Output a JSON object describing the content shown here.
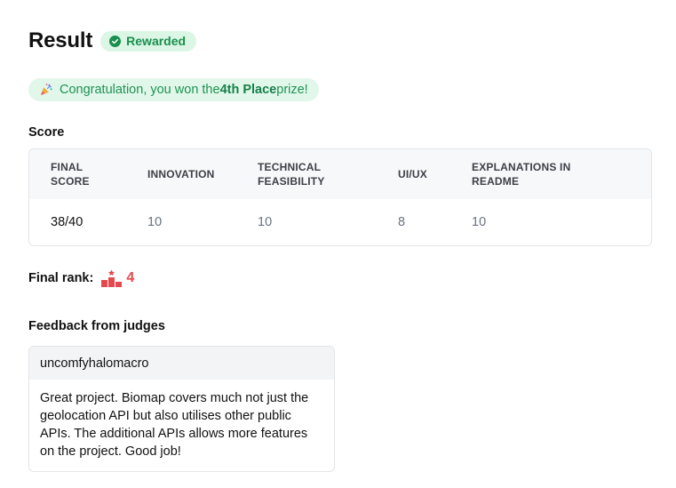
{
  "header": {
    "title": "Result",
    "badge": "Rewarded"
  },
  "congrats": {
    "prefix": "Congratulation, you won the ",
    "place": "4th Place",
    "suffix": " prize!"
  },
  "score": {
    "section_title": "Score",
    "columns": [
      {
        "line1": "FINAL",
        "line2": "SCORE"
      },
      {
        "line1": "INNOVATION",
        "line2": ""
      },
      {
        "line1": "TECHNICAL",
        "line2": "FEASIBILITY"
      },
      {
        "line1": "UI/UX",
        "line2": ""
      },
      {
        "line1": "EXPLANATIONS IN",
        "line2": "README"
      }
    ],
    "values": [
      "38/40",
      "10",
      "10",
      "8",
      "10"
    ]
  },
  "rank": {
    "label": "Final rank:",
    "value": "4"
  },
  "feedback": {
    "section_title": "Feedback from judges",
    "judge": "uncomfyhalomacro",
    "text": "Great project. Biomap covers much not just the geolocation API but also utilises other public APIs. The additional APIs allows more features on the project. Good job!"
  },
  "colors": {
    "badge_bg": "#dcf6e6",
    "badge_text": "#1a8f4c",
    "congrats_bg": "#e1f7ea",
    "congrats_text": "#1f9254",
    "rank_red": "#e5484d"
  }
}
